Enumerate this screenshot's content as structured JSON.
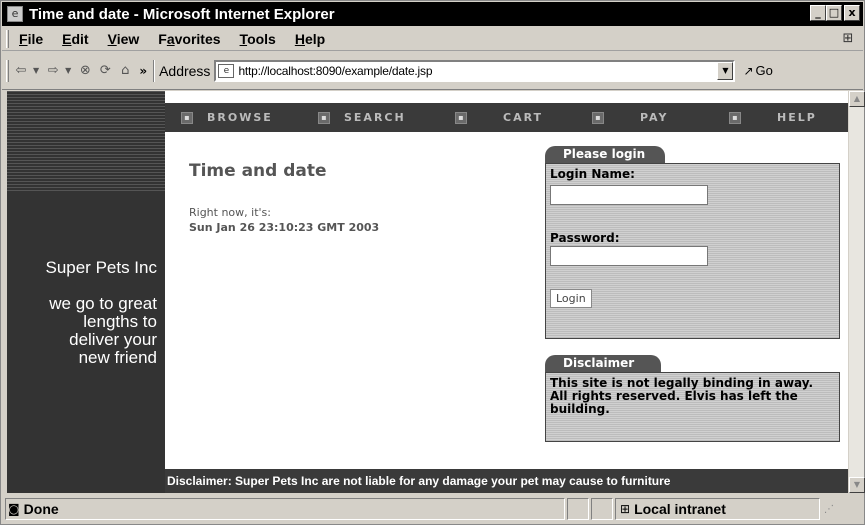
{
  "window": {
    "title": "Time and date - Microsoft Internet Explorer",
    "minimize_glyph": "_",
    "maximize_glyph": "□",
    "close_glyph": "x"
  },
  "menu": {
    "items": [
      {
        "key": "F",
        "rest": "ile"
      },
      {
        "key": "E",
        "rest": "dit"
      },
      {
        "key": "V",
        "rest": "iew"
      },
      {
        "key": "a",
        "prefix": "F",
        "rest": "vorites"
      },
      {
        "key": "T",
        "rest": "ools"
      },
      {
        "key": "H",
        "rest": "elp"
      }
    ]
  },
  "toolbar": {
    "chevron": "»",
    "address_label": "Address",
    "address_url": "http://localhost:8090/example/date.jsp",
    "go_label": "Go"
  },
  "site": {
    "company": "Super Pets Inc",
    "tagline": [
      "we go to great",
      "lengths to",
      "deliver your",
      "new friend"
    ],
    "nav": [
      "BROWSE",
      "SEARCH",
      "CART",
      "PAY",
      "HELP"
    ],
    "title": "Time and date",
    "subtitle": "Right now, it's:",
    "datetime": "Sun Jan 26 23:10:23 GMT 2003",
    "login": {
      "tab": "Please login",
      "name_label": "Login Name:",
      "password_label": "Password:",
      "button": "Login"
    },
    "disclaimer": {
      "tab": "Disclaimer",
      "line1": "This site is not legally binding in away.",
      "line2": "All rights reserved. Elvis has left the building."
    },
    "footer": "Disclaimer: Super Pets Inc are not liable for any damage your pet may cause to furniture"
  },
  "status": {
    "text": "Done",
    "zone": "Local intranet"
  }
}
